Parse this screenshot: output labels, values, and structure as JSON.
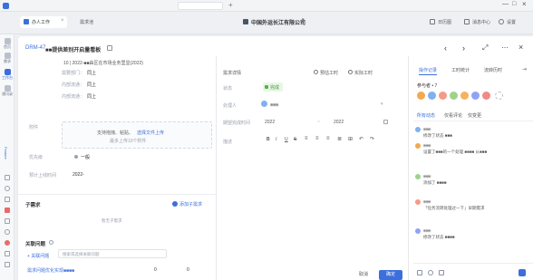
{
  "window": {
    "title": "中国外运长江有限公司",
    "right_links": [
      "日历图",
      "消息中心",
      "设置"
    ]
  },
  "tabs": [
    {
      "label": "办人工作"
    },
    {
      "label": "需求池"
    }
  ],
  "rail": {
    "items": [
      "首页",
      "需求",
      "工作台",
      "通讯录"
    ],
    "active_index": 2,
    "side_label": "Feature"
  },
  "ticket": {
    "id": "DRM-47",
    "title": "■■提供差别开启量看板",
    "desc": "10 | 2022-■■由区在市场业务里显(2022)",
    "fields": [
      {
        "label": "需要部门：",
        "value": "同上"
      },
      {
        "label": "内部流通：",
        "value": "同上"
      },
      {
        "label": "内部流通：",
        "value": "同上"
      }
    ],
    "attachment_label": "附件",
    "attachment_hint": "支持拖拽、粘贴、",
    "attachment_link": "选择文件上传",
    "attachment_limit": "最多上传10个附件",
    "priority_label": "优先级",
    "priority_value": "一般",
    "plan_date_label": "预计上线时间",
    "plan_date_value": "2022-",
    "subtask_title": "子需求",
    "subtask_add": "添加子需求",
    "subtask_empty": "暂无子需求",
    "linked_title": "关联问题",
    "linked_add": "+ 关联问题",
    "linked_search_placeholder": "搜索或选择关联问题",
    "linked_row": "需求问题优化实现■■■■",
    "linked_row_counts": [
      "0",
      "0"
    ]
  },
  "mid": {
    "tabs": [
      "需求详情",
      "预估工时",
      "实际工时"
    ],
    "status_label": "状态",
    "status_value": "完成",
    "owner_label": "处理人",
    "owner_value": "■■■",
    "date_label": "期望完成时间",
    "date_start": "2022",
    "date_end": "2022",
    "desc_label": "描述",
    "toolbar": [
      "B",
      "I",
      "U",
      "S",
      "≡",
      "≡",
      "≡",
      "≣",
      "⊞",
      "↶",
      "↷"
    ],
    "cancel": "取消",
    "confirm": "确定"
  },
  "right": {
    "tabs": [
      "操作记录",
      "工时统计",
      "流转历时"
    ],
    "participants_label": "参与者 • 7",
    "subtabs": [
      "所有动态",
      "仅看评论",
      "仅变更"
    ],
    "feed": [
      {
        "name": "■■■",
        "text": "修改了状态 ■■■",
        "time": ""
      },
      {
        "name": "■■■",
        "text": "设置了■■■的一个处理 ■■■■ 从■■■",
        "time": ""
      },
      {
        "name": "■■■",
        "text": "添加了 ■■■■",
        "time": ""
      },
      {
        "name": "■■■",
        "text": "「任务流转处理过一下」早期需求",
        "time": ""
      },
      {
        "name": "■■■",
        "text": "修改了状态 ■■■■",
        "time": ""
      }
    ],
    "avatar_colors": [
      "#f3a94d",
      "#7fb0f0",
      "#f49a86",
      "#9dd38b",
      "#f5b35f",
      "#8fa3f5",
      "#f08a8a"
    ]
  },
  "header_actions": [
    "prev-icon",
    "next-icon",
    "share-icon",
    "more-icon",
    "close-icon"
  ]
}
